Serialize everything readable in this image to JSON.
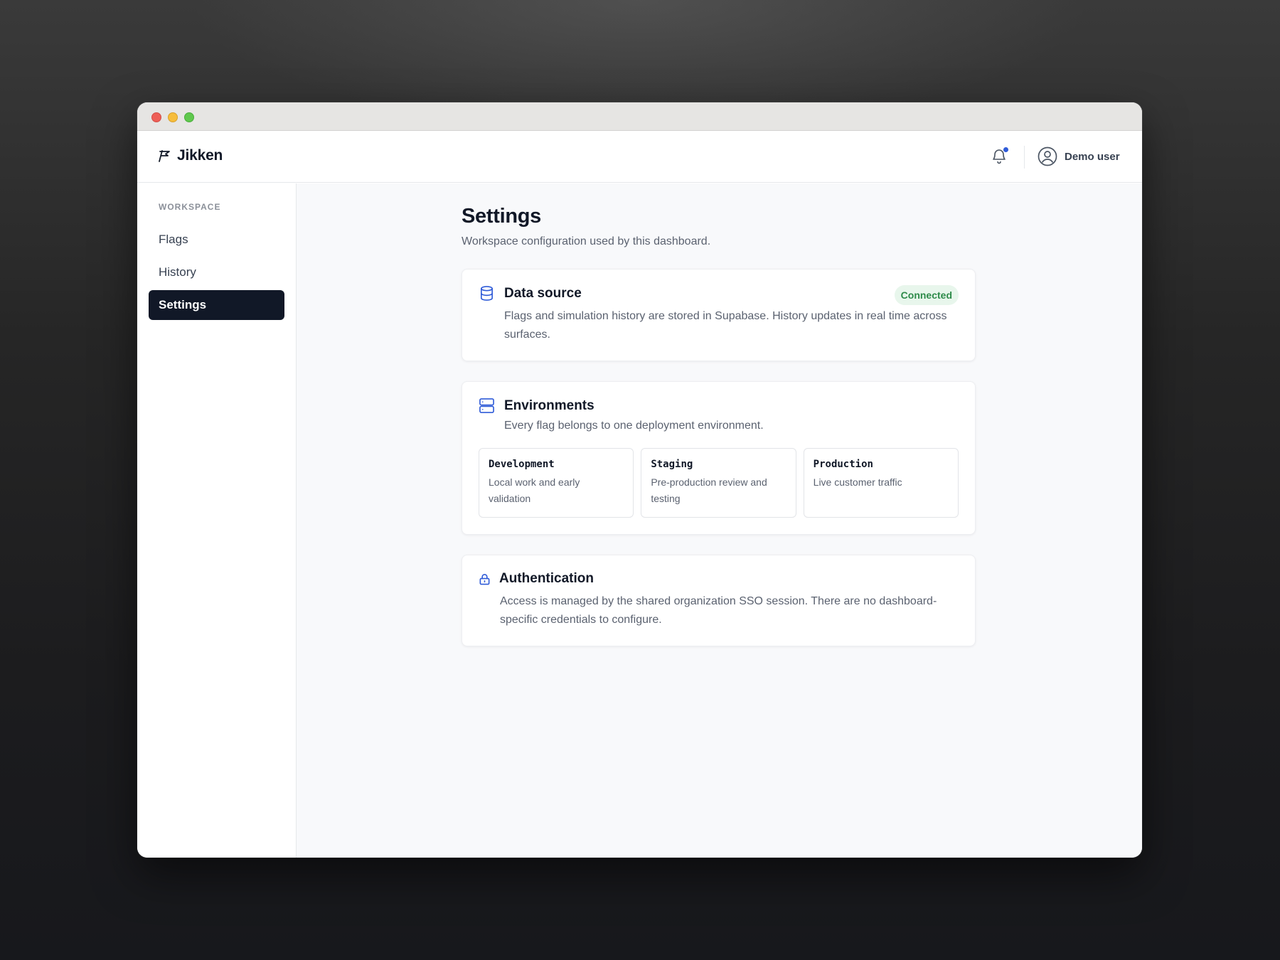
{
  "app": {
    "name": "Jikken"
  },
  "user": {
    "name": "Demo user"
  },
  "sidebar": {
    "section": "WORKSPACE",
    "items": [
      {
        "label": "Flags",
        "active": false
      },
      {
        "label": "History",
        "active": false
      },
      {
        "label": "Settings",
        "active": true
      }
    ]
  },
  "page": {
    "title": "Settings",
    "subtitle": "Workspace configuration used by this dashboard."
  },
  "cards": {
    "data_source": {
      "icon": "database-icon",
      "title": "Data source",
      "status": "Connected",
      "description": "Flags and simulation history are stored in Supabase. History updates in real time across surfaces."
    },
    "environments": {
      "icon": "server-icon",
      "title": "Environments",
      "description": "Every flag belongs to one deployment environment.",
      "items": [
        {
          "name": "Development",
          "description": "Local work and early validation"
        },
        {
          "name": "Staging",
          "description": "Pre-production review and testing"
        },
        {
          "name": "Production",
          "description": "Live customer traffic"
        }
      ]
    },
    "authentication": {
      "icon": "lock-icon",
      "title": "Authentication",
      "description": "Access is managed by the shared organization SSO session. There are no dashboard-specific credentials to configure."
    }
  },
  "colors": {
    "accent": "#2f5bd8",
    "active_nav": "#111827",
    "status_connected": "#2e8b4a"
  }
}
